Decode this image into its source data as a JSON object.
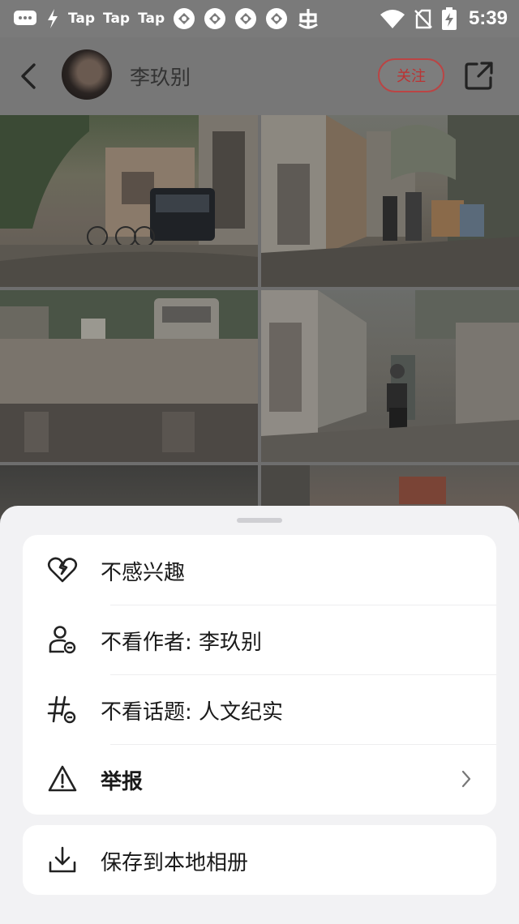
{
  "status_bar": {
    "tap_labels": [
      "Tap",
      "Tap",
      "Tap"
    ],
    "time": "5:39",
    "icons": [
      "message-icon",
      "bolt-icon",
      "tap-icon",
      "tap-icon",
      "tap-icon",
      "app-icon",
      "app-icon",
      "app-icon",
      "app-icon",
      "bug-icon",
      "wifi-icon",
      "no-sim-icon",
      "battery-charging-icon"
    ]
  },
  "header": {
    "author_name": "李玖别",
    "follow_label": "关注",
    "icons": [
      "back-icon",
      "share-icon"
    ],
    "accent_color": "#b33333"
  },
  "sheet": {
    "menu_items": [
      {
        "label": "不感兴趣",
        "icon": "broken-heart-icon"
      },
      {
        "label": "不看作者: 李玖别",
        "icon": "user-minus-icon"
      },
      {
        "label": "不看话题: 人文纪实",
        "icon": "hashtag-minus-icon"
      },
      {
        "label": "举报",
        "icon": "warning-icon",
        "has_chevron": true
      }
    ],
    "save_item": {
      "label": "保存到本地相册",
      "icon": "download-icon"
    }
  }
}
